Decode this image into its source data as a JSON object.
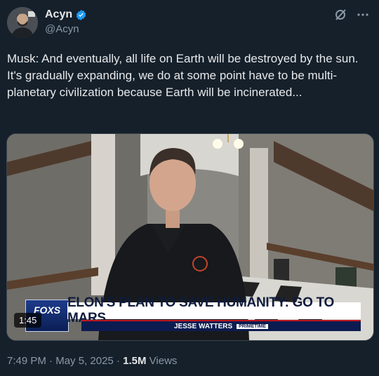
{
  "author": {
    "display_name": "Acyn",
    "handle": "@Acyn",
    "verified": true
  },
  "icons": {
    "verified": "verified-badge-icon",
    "grok": "grok-icon",
    "more": "more-icon"
  },
  "tweet": {
    "text": "Musk: And eventually, all life on Earth will be destroyed by the sun. It's gradually expanding, we do at some point have to be multi-planetary civilization because Earth will be incinerated..."
  },
  "video": {
    "duration": "1:45",
    "network_logo": "FOX",
    "network_logo_sub": "S",
    "headline": "ELON'S PLAN TO SAVE HUMANITY: GO TO MARS",
    "show_name": "JESSE WATTERS",
    "show_tag": "PRIMETIME"
  },
  "meta": {
    "time": "7:49 PM",
    "separator": " · ",
    "date": "May 5, 2025",
    "views_count": "1.5M",
    "views_label": "Views"
  },
  "colors": {
    "background": "#15202b",
    "text": "#e7e9ea",
    "muted": "#8b98a5",
    "verified": "#1d9bf0"
  }
}
